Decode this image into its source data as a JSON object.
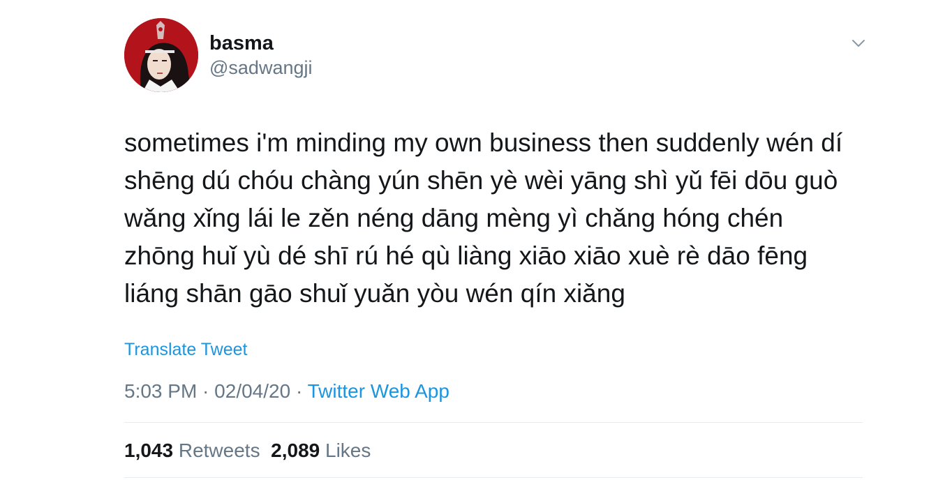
{
  "user": {
    "display_name": "basma",
    "handle": "@sadwangji"
  },
  "tweet": {
    "lines": [
      "sometimes i'm minding my own business then suddenly wén dí",
      "shēng dú chóu chàng yún shēn yè wèi yāng shì yǔ fēi dōu guò",
      "wǎng xǐng lái le zěn néng dāng mèng yì chǎng hóng chén",
      "zhōng huǐ yù dé shī rú hé qù liàng xiāo xiāo xuè rè dāo fēng",
      "liáng shān gāo shuǐ yuǎn yòu wén qín xiǎng"
    ],
    "translate_label": "Translate Tweet"
  },
  "meta": {
    "time": "5:03 PM",
    "separator1": " · ",
    "date": "02/04/20",
    "separator2": " · ",
    "source": "Twitter Web App"
  },
  "stats": {
    "retweets_count": "1,043",
    "retweets_label": "Retweets",
    "likes_count": "2,089",
    "likes_label": "Likes"
  },
  "icons": {
    "more_menu": "chevron-down-icon"
  },
  "colors": {
    "text_primary": "#14171a",
    "text_secondary": "#657786",
    "link": "#1b95e0",
    "divider": "#e6ecf0",
    "avatar_bg": "#b3141c"
  }
}
